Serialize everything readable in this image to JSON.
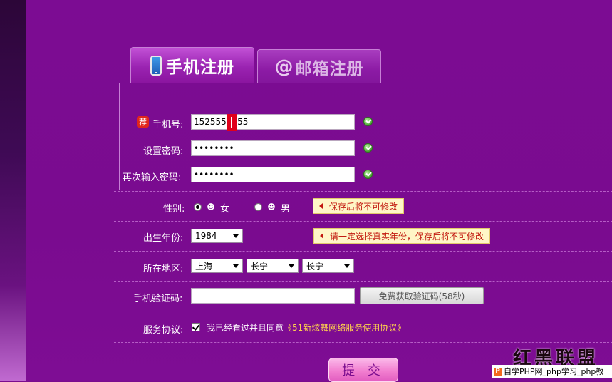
{
  "tabs": {
    "phone_label": "手机注册",
    "email_label": "邮箱注册",
    "email_at": "@"
  },
  "form": {
    "recommend_badge": "荐",
    "phone": {
      "label": "手机号:",
      "value": "1525555  55"
    },
    "password": {
      "label": "设置密码:",
      "value": "••••••••"
    },
    "password_confirm": {
      "label": "再次输入密码:",
      "value": "••••••••"
    },
    "gender": {
      "label": "性别:",
      "female": "女",
      "male": "男",
      "selected": "女",
      "tip": "保存后将不可修改"
    },
    "birth_year": {
      "label": "出生年份:",
      "value": "1984",
      "tip": "请一定选择真实年份，保存后将不可修改"
    },
    "region": {
      "label": "所在地区:",
      "province": "上海",
      "city": "长宁",
      "district": "长宁"
    },
    "sms_code": {
      "label": "手机验证码:",
      "value": "",
      "button": "免费获取验证码(58秒)"
    },
    "agreement": {
      "label": "服务协议:",
      "text": "我已经看过并且同意",
      "link": "《51新炫舞网络服务使用协议》"
    },
    "submit": "提 交"
  },
  "watermark": {
    "logo": "红黑联盟",
    "bar_icon": "P",
    "bar_text": "自学PHP网_php学习_php教"
  },
  "colors": {
    "background": "#7a0c8e",
    "tip_text": "#c2180f",
    "link": "#ffd24d",
    "submit": "#f27fd0"
  }
}
